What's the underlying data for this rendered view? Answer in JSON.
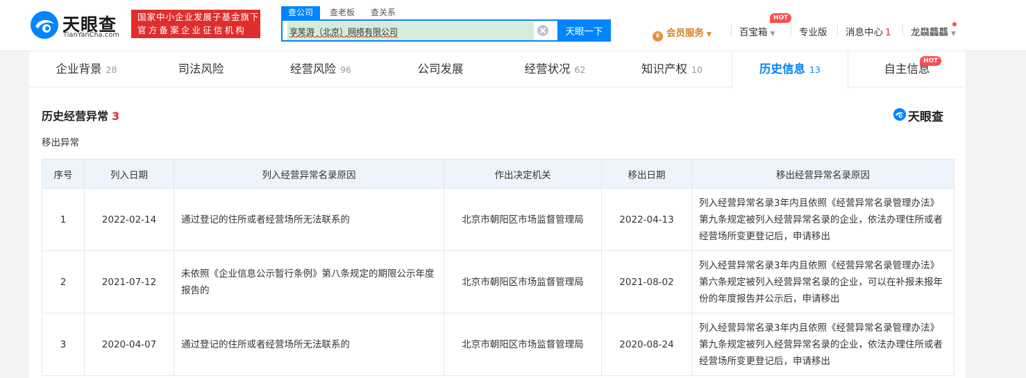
{
  "brand": {
    "name": "天眼查",
    "domain": "TianYanCha.com",
    "badge_line1": "国家中小企业发展子基金旗下",
    "badge_line2": "官方备案企业征信机构"
  },
  "search": {
    "tabs": [
      "查公司",
      "查老板",
      "查关系"
    ],
    "value": "享笑游（北京）网络有限公司",
    "button_label": "天眼一下"
  },
  "topnav": {
    "vip_label": "会员服务",
    "toolbox_label": "百宝箱",
    "hot_label": "HOT",
    "pro_label": "专业版",
    "messages_label": "消息中心",
    "messages_count": "1",
    "user_name": "龙飝龘龘"
  },
  "tabs": [
    {
      "label": "企业背景",
      "count": "28"
    },
    {
      "label": "司法风险",
      "count": ""
    },
    {
      "label": "经营风险",
      "count": "96"
    },
    {
      "label": "公司发展",
      "count": ""
    },
    {
      "label": "经营状况",
      "count": "62"
    },
    {
      "label": "知识产权",
      "count": "10"
    },
    {
      "label": "历史信息",
      "count": "13"
    },
    {
      "label": "自主信息",
      "count": ""
    }
  ],
  "section": {
    "title": "历史经营异常",
    "count": "3",
    "subtitle": "移出异常",
    "watermark": "天眼查"
  },
  "table": {
    "headers": [
      "序号",
      "列入日期",
      "列入经营异常名录原因",
      "作出决定机关",
      "移出日期",
      "移出经营异常名录原因"
    ],
    "rows": [
      {
        "no": "1",
        "in_date": "2022-02-14",
        "in_reason": "通过登记的住所或者经营场所无法联系的",
        "authority": "北京市朝阳区市场监督管理局",
        "out_date": "2022-04-13",
        "out_reason": "列入经营异常名录3年内且依照《经营异常名录管理办法》第九条规定被列入经营异常名录的企业，依法办理住所或者经营场所变更登记后，申请移出"
      },
      {
        "no": "2",
        "in_date": "2021-07-12",
        "in_reason": "未依照《企业信息公示暂行条例》第八条规定的期限公示年度报告的",
        "authority": "北京市朝阳区市场监督管理局",
        "out_date": "2021-08-02",
        "out_reason": "列入经营异常名录3年内且依照《经营异常名录管理办法》第六条规定被列入经营异常名录的企业，可以在补报未报年份的年度报告并公示后，申请移出"
      },
      {
        "no": "3",
        "in_date": "2020-04-07",
        "in_reason": "通过登记的住所或者经营场所无法联系的",
        "authority": "北京市朝阳区市场监督管理局",
        "out_date": "2020-08-24",
        "out_reason": "列入经营异常名录3年内且依照《经营异常名录管理办法》第九条规定被列入经营异常名录的企业，依法办理住所或者经营场所变更登记后，申请移出"
      }
    ]
  },
  "colors": {
    "accent": "#0084ff",
    "danger": "#e02d2d",
    "vip": "#d9822b",
    "header_bg": "#eef4fc"
  }
}
